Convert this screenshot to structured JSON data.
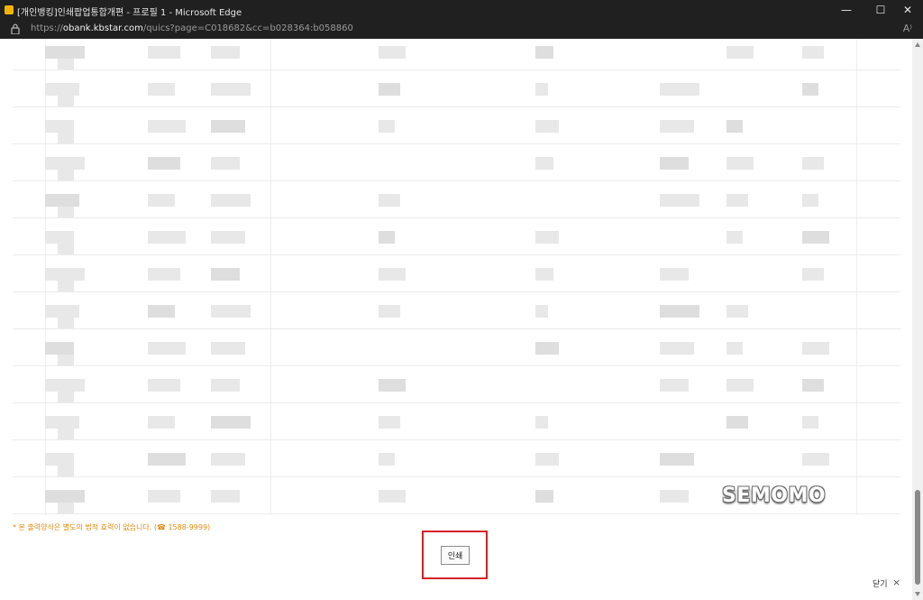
{
  "window": {
    "title": "[개인뱅킹]인쇄팝업통합개편 - 프로필 1 - Microsoft Edge",
    "controls": {
      "minimize": "—",
      "maximize": "☐",
      "close": "✕"
    }
  },
  "address_bar": {
    "scheme": "https://",
    "host": "obank.kbstar.com",
    "path": "/quics?page=C018682&cc=b028364:b058860",
    "read_aloud": "A⁾"
  },
  "footer": {
    "notice": "* 본 출력양식은 별도의 법적 효력이 없습니다. (☎ 1588-9999)",
    "print_label": "인쇄",
    "close_label": "닫기",
    "close_icon": "×"
  },
  "watermark": "SEMOMO",
  "colors": {
    "notice": "#e08a0c",
    "highlight": "#d71f26"
  },
  "icons": [
    "app-icon",
    "lock-icon",
    "read-aloud-icon",
    "close-icon"
  ]
}
